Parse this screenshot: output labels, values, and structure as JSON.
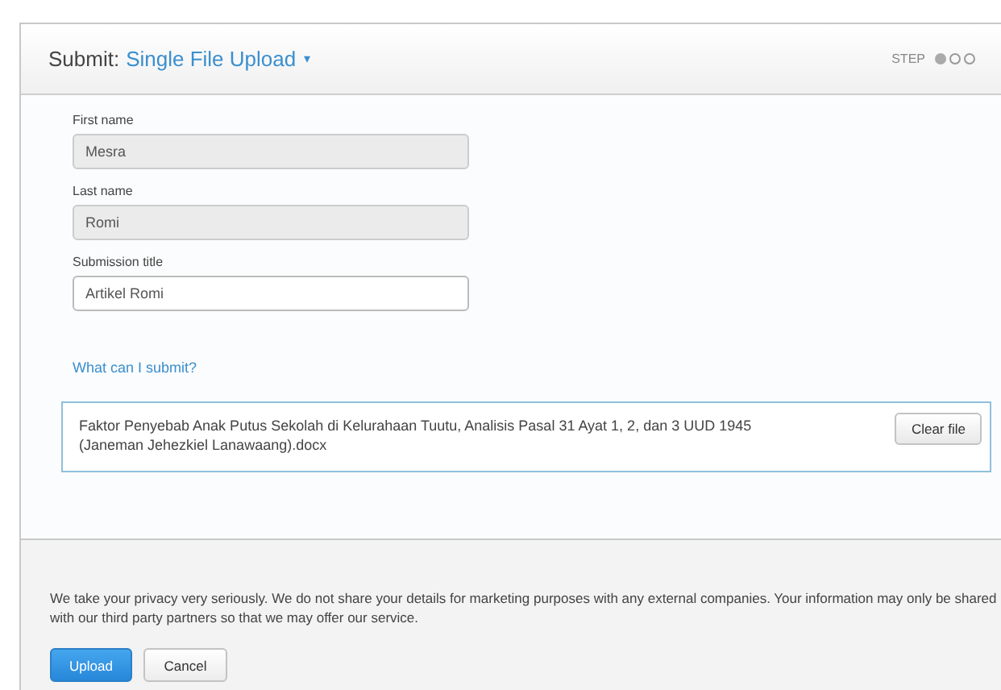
{
  "header": {
    "prefix": "Submit:",
    "title": "Single File Upload",
    "caret": "▾",
    "step_label": "STEP",
    "steps": [
      {
        "selected": true
      },
      {
        "selected": false
      },
      {
        "selected": false
      }
    ]
  },
  "fields": [
    {
      "label": "First name",
      "value": "Mesra",
      "disabled": true
    },
    {
      "label": "Last name",
      "value": "Romi",
      "disabled": true
    },
    {
      "label": "Submission title",
      "value": "Artikel Romi",
      "disabled": false
    }
  ],
  "help_link": "What can I submit?",
  "file": {
    "name": "Faktor Penyebab Anak Putus Sekolah di Kelurahaan Tuutu, Analisis Pasal 31 Ayat 1, 2, dan 3 UUD 1945 (Janeman Jehezkiel Lanawaang).docx",
    "clear_button": "Clear file"
  },
  "privacy_text": "We take your privacy very seriously. We do not share your details for marketing purposes with any external companies. Your information may only be shared with our third party partners so that we may offer our service.",
  "buttons": [
    {
      "label": "Upload",
      "kind": "primary"
    },
    {
      "label": "Cancel",
      "kind": "secondary"
    }
  ]
}
